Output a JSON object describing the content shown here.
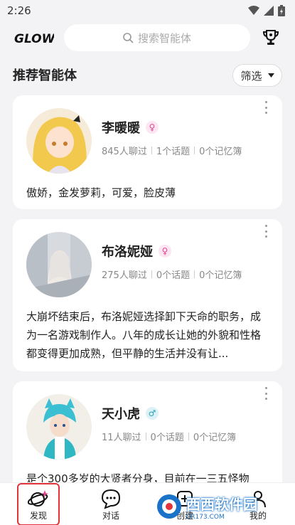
{
  "status_bar": {
    "time": "2:26"
  },
  "header": {
    "logo_text": "GLOW",
    "search_placeholder": "搜索智能体"
  },
  "section": {
    "title": "推荐智能体",
    "filter_label": "筛选"
  },
  "cards": [
    {
      "name": "李暖暖",
      "gender": "♀",
      "chats": "845人聊过",
      "topics": "1个话题",
      "memories": "0个记忆簿",
      "description": "傲娇，金发萝莉，可爱，脸皮薄"
    },
    {
      "name": "布洛妮娅",
      "gender": "♀",
      "chats": "275人聊过",
      "topics": "0个话题",
      "memories": "0个记忆簿",
      "description": "大崩坏结束后，布洛妮娅选择卸下天命的职务，成为一名游戏制作人。八年的成长让她的外貌和性格都变得更加成熟，但平静的生活并没有让..."
    },
    {
      "name": "天小虎",
      "gender": "♂",
      "chats": "11人聊过",
      "topics": "0个话题",
      "memories": "0个记忆簿",
      "description": "是个300多岁的大贤者分身，目前在一三五怪物"
    }
  ],
  "tabbar": {
    "tabs": [
      {
        "label": "发现",
        "icon": "planet-icon"
      },
      {
        "label": "对话",
        "icon": "chat-bubble-icon"
      },
      {
        "label": "创建",
        "icon": "create-icon"
      },
      {
        "label": "我的",
        "icon": "profile-icon"
      }
    ]
  },
  "watermark": {
    "text": "西西软件园",
    "sub": "CR173.COM"
  },
  "colors": {
    "active_outline": "#e0353b",
    "female": "#e14690",
    "male": "#2aa0b8"
  }
}
